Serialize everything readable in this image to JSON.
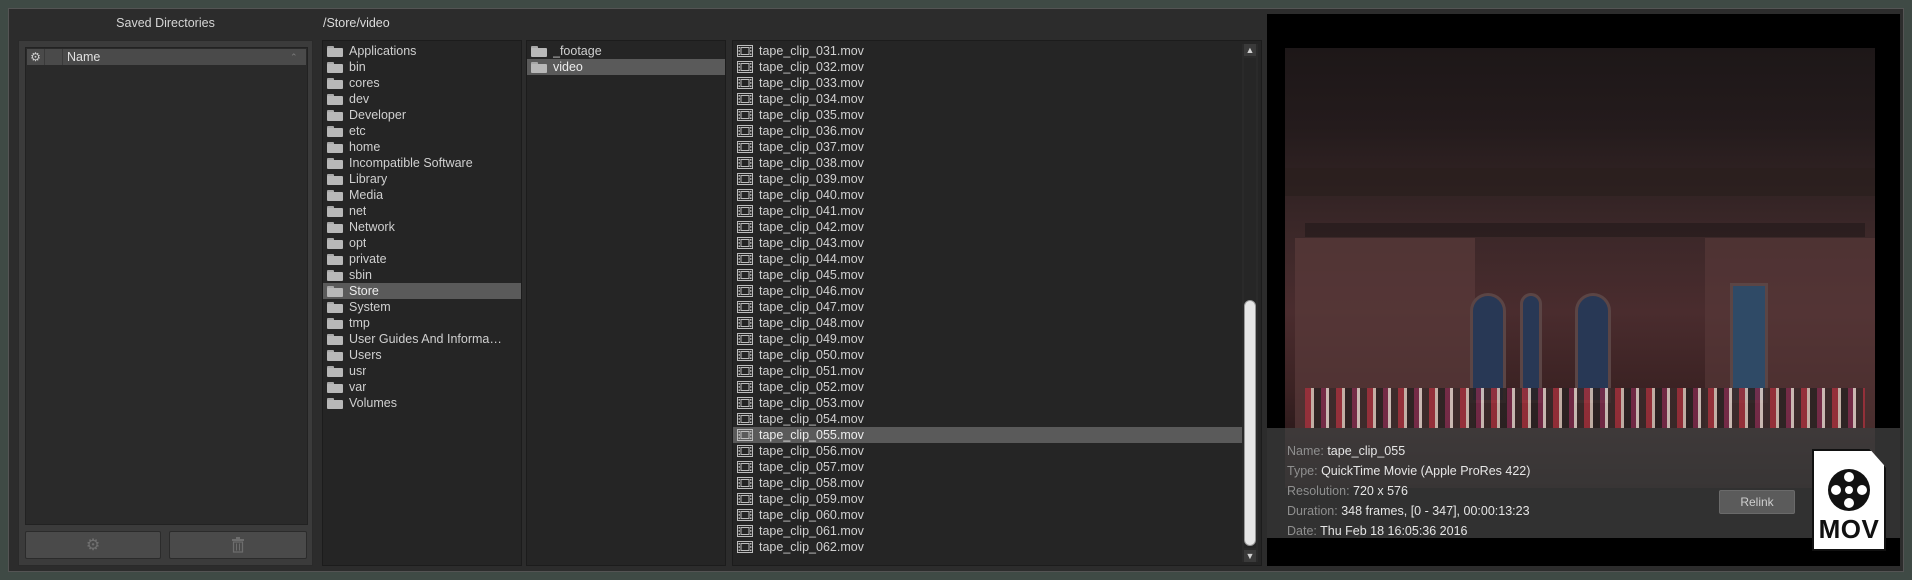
{
  "saved_directories": {
    "title": "Saved Directories",
    "column_name": "Name",
    "items": [],
    "add_icon": "gear-icon",
    "delete_icon": "trash-icon"
  },
  "path": "/Store/video",
  "columns": {
    "root": {
      "selected": "Store",
      "items": [
        "Applications",
        "bin",
        "cores",
        "dev",
        "Developer",
        "etc",
        "home",
        "Incompatible Software",
        "Library",
        "Media",
        "net",
        "Network",
        "opt",
        "private",
        "sbin",
        "Store",
        "System",
        "tmp",
        "User Guides And Informa…",
        "Users",
        "usr",
        "var",
        "Volumes"
      ]
    },
    "store": {
      "selected": "video",
      "items": [
        "_footage",
        "video"
      ]
    },
    "video": {
      "selected": "tape_clip_055.mov",
      "items": [
        "tape_clip_031.mov",
        "tape_clip_032.mov",
        "tape_clip_033.mov",
        "tape_clip_034.mov",
        "tape_clip_035.mov",
        "tape_clip_036.mov",
        "tape_clip_037.mov",
        "tape_clip_038.mov",
        "tape_clip_039.mov",
        "tape_clip_040.mov",
        "tape_clip_041.mov",
        "tape_clip_042.mov",
        "tape_clip_043.mov",
        "tape_clip_044.mov",
        "tape_clip_045.mov",
        "tape_clip_046.mov",
        "tape_clip_047.mov",
        "tape_clip_048.mov",
        "tape_clip_049.mov",
        "tape_clip_050.mov",
        "tape_clip_051.mov",
        "tape_clip_052.mov",
        "tape_clip_053.mov",
        "tape_clip_054.mov",
        "tape_clip_055.mov",
        "tape_clip_056.mov",
        "tape_clip_057.mov",
        "tape_clip_058.mov",
        "tape_clip_059.mov",
        "tape_clip_060.mov",
        "tape_clip_061.mov",
        "tape_clip_062.mov"
      ]
    }
  },
  "preview": {
    "name_label": "Name:",
    "name_value": "tape_clip_055",
    "type_label": "Type:",
    "type_value": "QuickTime Movie (Apple ProRes 422)",
    "resolution_label": "Resolution:",
    "resolution_value": "720 x 576",
    "duration_label": "Duration:",
    "duration_value": "348 frames, [0 - 347], 00:00:13:23",
    "date_label": "Date:",
    "date_value": "Thu Feb 18 16:05:36 2016",
    "relink_label": "Relink",
    "badge_text": "MOV"
  }
}
